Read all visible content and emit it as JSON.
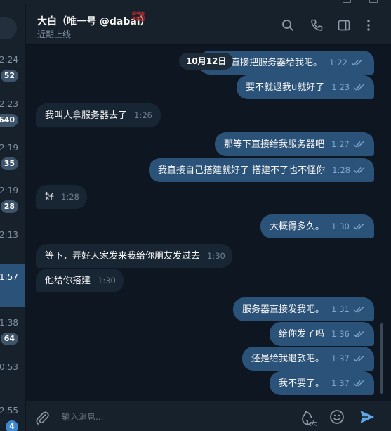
{
  "chatlist": {
    "items": [
      {
        "time": "2:24",
        "badge": "52"
      },
      {
        "time": "2:23",
        "badge": "640"
      },
      {
        "time": "2:19",
        "badge": "35"
      },
      {
        "time": "2:19",
        "badge": "28"
      },
      {
        "time": "2:13",
        "badge": ""
      },
      {
        "time": "1:57",
        "badge": "",
        "active": true
      },
      {
        "time": "1:38",
        "badge": "64"
      },
      {
        "time": "0:53",
        "badge": ""
      },
      {
        "time": "2:55",
        "badge": "4"
      }
    ]
  },
  "header": {
    "title": "大白（唯一号 @dabai）",
    "stamp": "群爷客 天客服",
    "status": "近期上线",
    "icons": [
      "search-icon",
      "phone-icon",
      "sidebar-icon",
      "more-icon"
    ]
  },
  "messages": {
    "date": "10月12日",
    "items": [
      {
        "dir": "out",
        "text": "直接把服务器给我吧。",
        "time": "1:22",
        "read": true
      },
      {
        "dir": "out",
        "text": "要不就退我u就好了",
        "time": "1:23",
        "read": true
      },
      {
        "dir": "in",
        "text": "我叫人拿服务器去了",
        "time": "1:26"
      },
      {
        "dir": "out",
        "text": "那等下直接给我服务器吧",
        "time": "1:27",
        "read": true
      },
      {
        "dir": "out",
        "text": "我直接自己搭建就好了 搭建不了也不怪你",
        "time": "1:28",
        "read": true
      },
      {
        "dir": "in",
        "text": "好",
        "time": "1:28"
      },
      {
        "dir": "out",
        "text": "大概得多久。",
        "time": "1:30",
        "read": true
      },
      {
        "dir": "in",
        "text": "等下，弄好人家发来我给你朋友发过去",
        "time": "1:30"
      },
      {
        "dir": "in",
        "text": "他给你搭建",
        "time": "1:30"
      },
      {
        "dir": "out",
        "text": "服务器直接发我吧。",
        "time": "1:31",
        "read": true
      },
      {
        "dir": "out",
        "text": "给你发了吗",
        "time": "1:36",
        "read": true
      },
      {
        "dir": "out",
        "text": "还是给我退款吧。",
        "time": "1:37",
        "read": true
      },
      {
        "dir": "out",
        "text": "我不要了。",
        "time": "1:37",
        "read": true
      }
    ]
  },
  "composer": {
    "placeholder": "输入消息...",
    "timer_label": "1天"
  },
  "colors": {
    "background": "#0e1621",
    "panel": "#17212b",
    "incoming_bubble": "#182533",
    "outgoing_bubble": "#2b5278",
    "accent": "#5fa7e8"
  }
}
